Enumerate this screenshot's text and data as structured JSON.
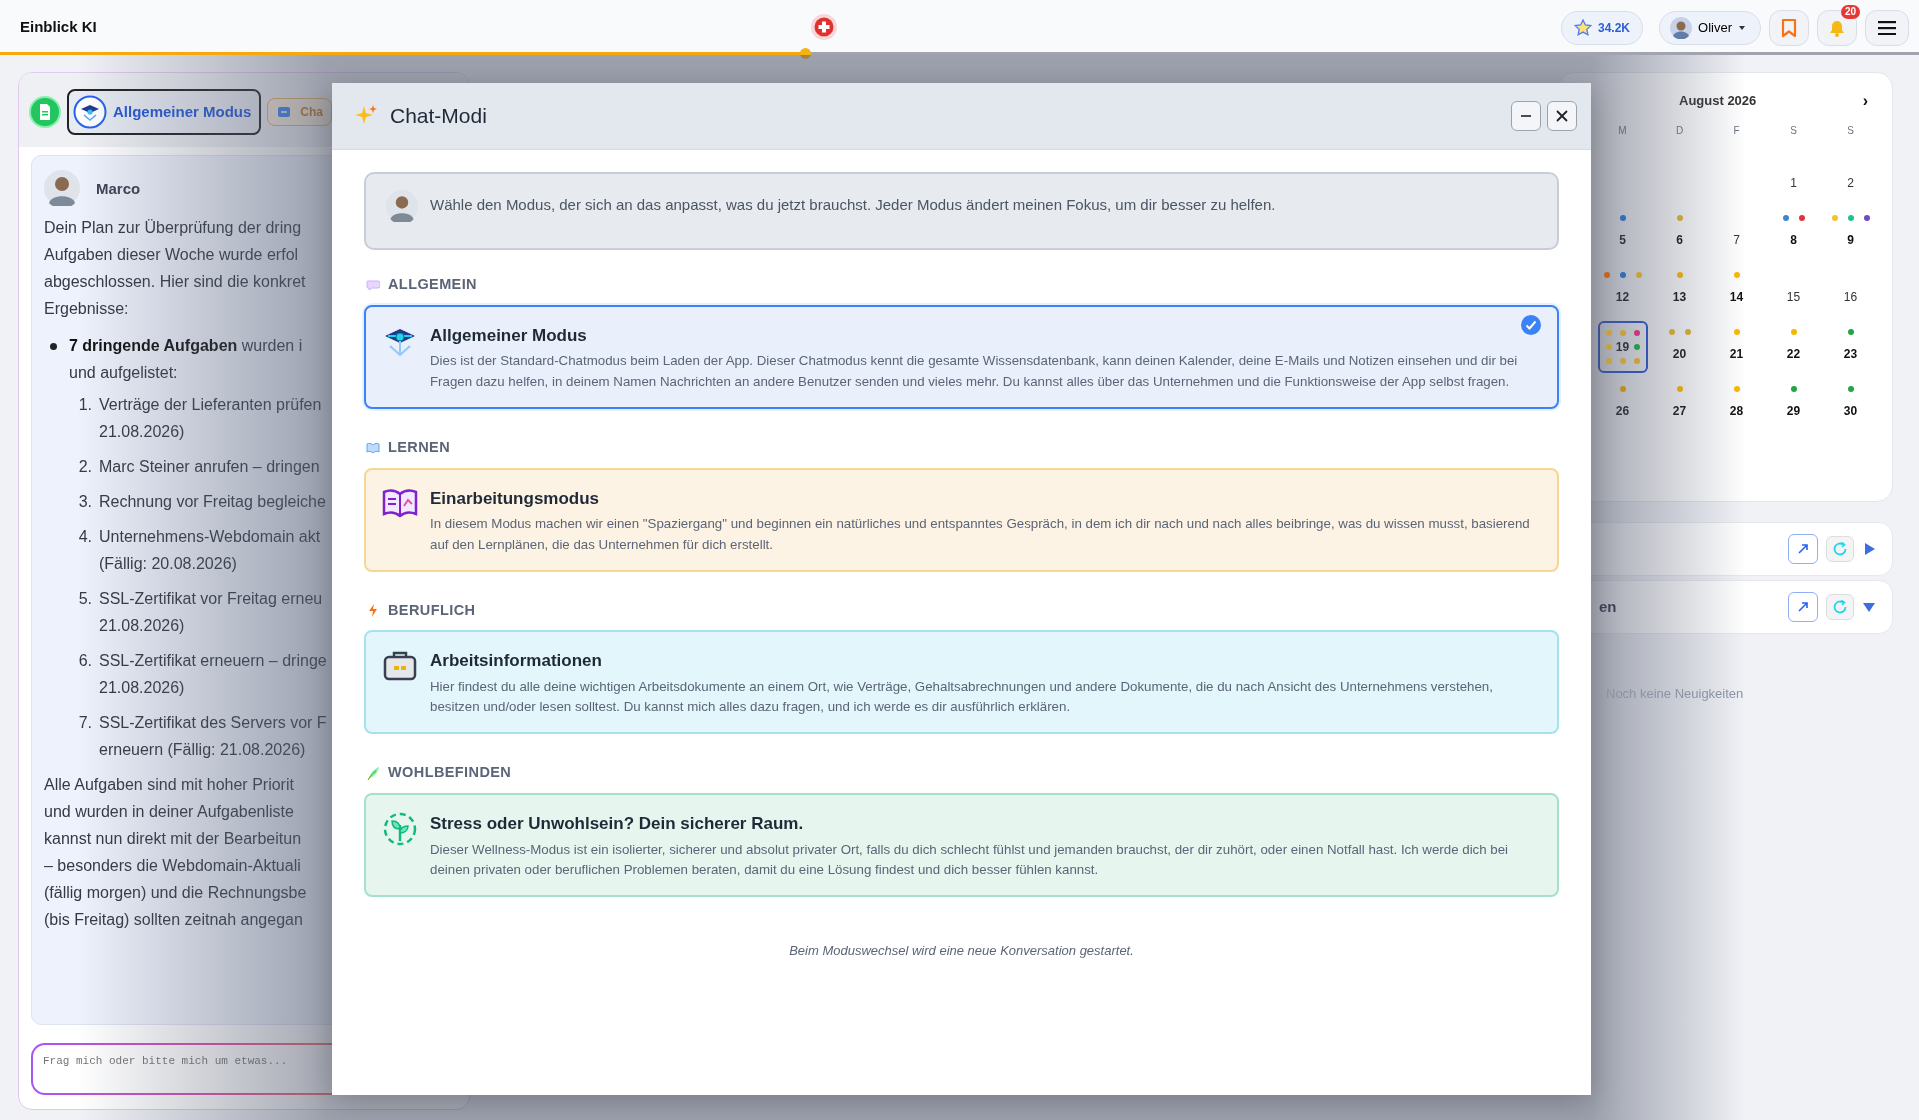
{
  "app": {
    "title": "Einblick KI",
    "favorites_count": "34.2K",
    "user": "Oliver",
    "notifications": "20"
  },
  "loading_bar": {
    "level": 0.42
  },
  "chat_panel": {
    "tabs": [
      {
        "kind": "mode",
        "label": "Allgemeiner Modus",
        "selected": true
      },
      {
        "kind": "chat",
        "label": "Cha",
        "selected": false
      }
    ],
    "message": {
      "author": "Marco",
      "intro": [
        "Dein Plan zur Überprüfung der dring",
        "Aufgaben dieser Woche wurde erfol",
        "abgeschlossen. Hier sind die konkret",
        "Ergebnisse:"
      ],
      "bullet": [
        "**7 dringende Aufgaben** wurden i",
        "und aufgelistet:"
      ],
      "steps": [
        {
          "number": "1.",
          "lines": [
            "Verträge der Lieferanten prüfen",
            "21.08.2026)"
          ]
        },
        {
          "number": "2.",
          "lines": [
            "Marc Steiner anrufen – dringen"
          ]
        },
        {
          "number": "3.",
          "lines": [
            "Rechnung vor Freitag begleiche"
          ]
        },
        {
          "number": "4.",
          "lines": [
            "Unternehmens-Webdomain akt",
            "(Fällig: 20.08.2026)"
          ]
        },
        {
          "number": "5.",
          "lines": [
            "SSL-Zertifikat vor Freitag erneu",
            "21.08.2026)"
          ]
        },
        {
          "number": "6.",
          "lines": [
            "SSL-Zertifikat erneuern – dringe",
            "21.08.2026)"
          ]
        },
        {
          "number": "7.",
          "lines": [
            "SSL-Zertifikat des Servers vor F",
            "erneuern (Fällig: 21.08.2026)"
          ]
        }
      ],
      "closing": [
        "Alle Aufgaben sind mit hoher Priorit",
        "und wurden in deiner Aufgabenliste",
        "kannst nun direkt mit der Bearbeitun",
        "– besonders die Webdomain-Aktuali",
        "(fällig morgen) und die Rechnungsbe",
        "(bis Freitag) sollten zeitnah angegan"
      ]
    },
    "input": {
      "placeholder": "Frag mich oder bitte mich um etwas..."
    }
  },
  "calendar": {
    "month": "August 2026",
    "next": "›",
    "weekdays": [
      "M",
      "D",
      "F",
      "S",
      "S"
    ],
    "weeks": [
      [
        {
          "day": "1",
          "selected": false
        },
        {
          "day": "2",
          "selected": false
        }
      ],
      [
        {
          "day": "5",
          "selected": false,
          "dots": [
            {
              "color": "#2f6db5"
            }
          ]
        },
        {
          "day": "6",
          "selected": false,
          "dots": [
            {
              "color": "#c9a13b"
            }
          ]
        },
        {
          "day": "7",
          "selected": false
        },
        {
          "day": "8",
          "selected": false,
          "dots": [
            {
              "color": "#3a86d4"
            },
            {
              "color": "#e0313d"
            }
          ]
        },
        {
          "day": "9",
          "selected": false,
          "dots": [
            {
              "color": "#f4c12f"
            },
            {
              "color": "#21c38b"
            },
            {
              "color": "#7048c8"
            }
          ]
        }
      ],
      [
        {
          "day": "12",
          "selected": false,
          "dots": [
            {
              "color": "#c0651d"
            },
            {
              "color": "#2f6db5"
            },
            {
              "color": "#c9a13b"
            }
          ]
        },
        {
          "day": "13",
          "selected": false,
          "dots": [
            {
              "color": "#dba511"
            }
          ]
        },
        {
          "day": "14",
          "selected": false,
          "dots": [
            {
              "color": "#f4b800"
            }
          ]
        },
        {
          "day": "15",
          "selected": false
        },
        {
          "day": "16",
          "selected": false
        }
      ],
      [
        {
          "day": "19",
          "selected": true,
          "dots": [
            {
              "color": "#c9a13b"
            },
            {
              "color": "#c9a13b"
            },
            {
              "color": "#c8387a"
            },
            {
              "color": "#c9a13b"
            },
            {
              "color": "#1f9e49"
            },
            {
              "color": "#c9a13b"
            },
            {
              "color": "#c9a13b"
            },
            {
              "color": "#c9a13b"
            }
          ]
        },
        {
          "day": "20",
          "selected": false,
          "dots": [
            {
              "color": "#c9a13b"
            },
            {
              "color": "#c9a13b"
            }
          ]
        },
        {
          "day": "21",
          "selected": false,
          "dots": [
            {
              "color": "#f4b800"
            }
          ]
        },
        {
          "day": "22",
          "selected": false,
          "dots": [
            {
              "color": "#f4b800"
            }
          ]
        },
        {
          "day": "23",
          "selected": false,
          "dots": [
            {
              "color": "#22a447"
            }
          ]
        }
      ],
      [
        {
          "day": "26",
          "selected": false,
          "dots": [
            {
              "color": "#b8901c"
            }
          ]
        },
        {
          "day": "27",
          "selected": false,
          "dots": [
            {
              "color": "#dba511"
            }
          ]
        },
        {
          "day": "28",
          "selected": false,
          "dots": [
            {
              "color": "#f4b800"
            }
          ]
        },
        {
          "day": "29",
          "selected": false,
          "dots": [
            {
              "color": "#22a447"
            }
          ]
        },
        {
          "day": "30",
          "selected": false,
          "dots": [
            {
              "color": "#22a447"
            }
          ]
        }
      ]
    ]
  },
  "widgets": [
    {
      "expanded": false
    },
    {
      "title": "en",
      "expanded": true
    }
  ],
  "news_empty": "Noch keine Neuigkeiten",
  "modal": {
    "title": "Chat-Modi",
    "intro": "Wähle den Modus, der sich an das anpasst, was du jetzt brauchst. Jeder Modus ändert meinen Fokus, um dir besser zu helfen.",
    "sections": [
      {
        "kind": "general",
        "label": "ALLGEMEIN",
        "mode": {
          "title": "Allgemeiner Modus",
          "description": "Dies ist der Standard-Chatmodus beim Laden der App. Dieser Chatmodus kennt die gesamte Wissensdatenbank, kann deinen Kalender, deine E-Mails und Notizen einsehen und dir bei Fragen dazu helfen, in deinem Namen Nachrichten an andere Benutzer senden und vieles mehr. Du kannst alles über das Unternehmen und die Funktionsweise der App selbst fragen.",
          "selected": true
        }
      },
      {
        "kind": "learning",
        "label": "LERNEN",
        "mode": {
          "title": "Einarbeitungsmodus",
          "description": "In diesem Modus machen wir einen \"Spaziergang\" und beginnen ein natürliches und entspanntes Gespräch, in dem ich dir nach und nach alles beibringe, was du wissen musst, basierend auf den Lernplänen, die das Unternehmen für dich erstellt.",
          "selected": false
        }
      },
      {
        "kind": "work",
        "label": "BERUFLICH",
        "mode": {
          "title": "Arbeitsinformationen",
          "description": "Hier findest du alle deine wichtigen Arbeitsdokumente an einem Ort, wie Verträge, Gehaltsabrechnungen und andere Dokumente, die du nach Ansicht des Unternehmens verstehen, besitzen und/oder lesen solltest. Du kannst mich alles dazu fragen, und ich werde es dir ausführlich erklären.",
          "selected": false
        }
      },
      {
        "kind": "wellbeing",
        "label": "WOHLBEFINDEN",
        "mode": {
          "title": "Stress oder Unwohlsein? Dein sicherer Raum.",
          "description": "Dieser Wellness-Modus ist ein isolierter, sicherer und absolut privater Ort, falls du dich schlecht fühlst und jemanden brauchst, der dir zuhört, oder einen Notfall hast. Ich werde dich bei deinen privaten oder beruflichen Problemen beraten, damit du eine Lösung findest und dich besser fühlen kannst.",
          "selected": false
        }
      }
    ],
    "footer_note": "Beim Moduswechsel wird eine neue Konversation gestartet."
  }
}
